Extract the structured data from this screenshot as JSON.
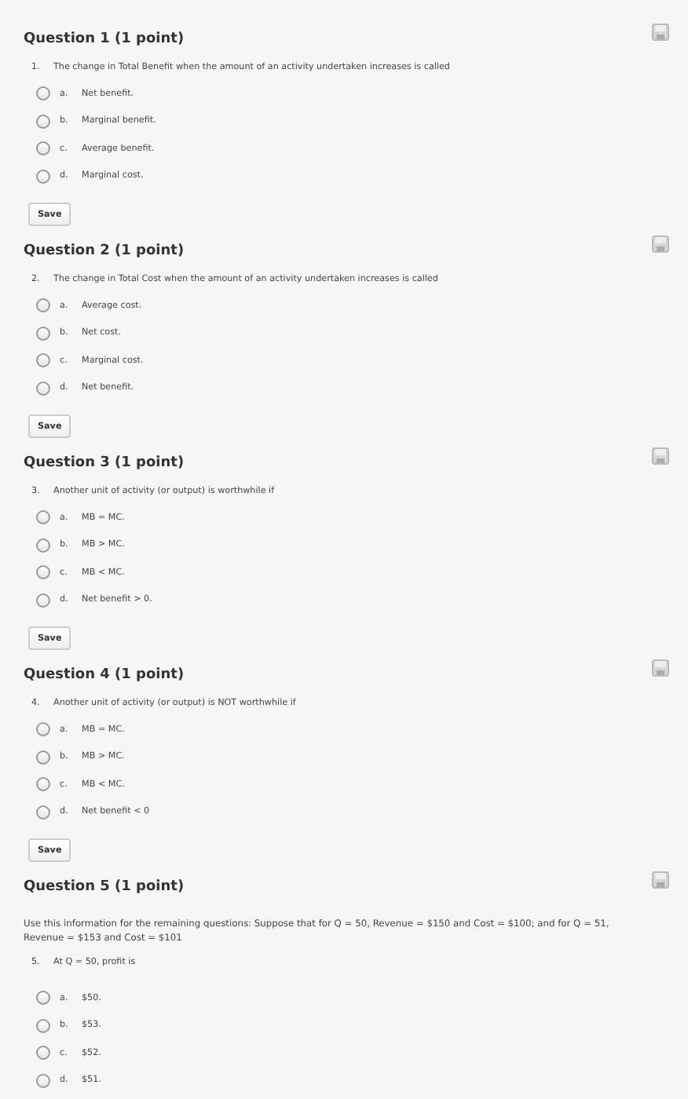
{
  "questions": [
    {
      "title": "Question 1 (1 point)",
      "number": "1.",
      "prompt": "The change in Total Benefit when the amount of an activity undertaken increases is called",
      "options": [
        {
          "letter": "a.",
          "text": "Net benefit.",
          "selected": false
        },
        {
          "letter": "b.",
          "text": "Marginal benefit.",
          "selected": false
        },
        {
          "letter": "c.",
          "text": "Average benefit.",
          "selected": false
        },
        {
          "letter": "d.",
          "text": "Marginal cost.",
          "selected": false
        }
      ],
      "save": "Save"
    },
    {
      "title": "Question 2 (1 point)",
      "number": "2.",
      "prompt": "The change in Total Cost when the amount of an activity undertaken increases is called",
      "options": [
        {
          "letter": "a.",
          "text": "Average cost.",
          "selected": false
        },
        {
          "letter": "b.",
          "text": "Net cost.",
          "selected": false
        },
        {
          "letter": "c.",
          "text": "Marginal cost.",
          "selected": false
        },
        {
          "letter": "d.",
          "text": "Net benefit.",
          "selected": false
        }
      ],
      "save": "Save"
    },
    {
      "title": "Question 3 (1 point)",
      "number": "3.",
      "prompt": "Another unit of activity (or output) is worthwhile if",
      "options": [
        {
          "letter": "a.",
          "text": "MB = MC.",
          "selected": false
        },
        {
          "letter": "b.",
          "text": "MB > MC.",
          "selected": false
        },
        {
          "letter": "c.",
          "text": "MB < MC.",
          "selected": false
        },
        {
          "letter": "d.",
          "text": "Net benefit > 0.",
          "selected": false
        }
      ],
      "save": "Save"
    },
    {
      "title": "Question 4 (1 point)",
      "number": "4.",
      "prompt": "Another unit of activity (or output) is NOT worthwhile if",
      "options": [
        {
          "letter": "a.",
          "text": "MB = MC.",
          "selected": false
        },
        {
          "letter": "b.",
          "text": "MB > MC.",
          "selected": false
        },
        {
          "letter": "c.",
          "text": "MB < MC.",
          "selected": false
        },
        {
          "letter": "d.",
          "text": "Net benefit < 0",
          "selected": false
        }
      ],
      "save": "Save"
    },
    {
      "title": "Question 5 (1 point)",
      "intro": "Use this information for the remaining questions: Suppose that for Q = 50, Revenue = $150 and Cost = $100; and for Q = 51, Revenue = $153 and Cost = $101",
      "number": "5.",
      "prompt": "At Q = 50, profit is",
      "options": [
        {
          "letter": "a.",
          "text": "$50.",
          "selected": false
        },
        {
          "letter": "b.",
          "text": "$53.",
          "selected": false
        },
        {
          "letter": "c.",
          "text": "$52.",
          "selected": false
        },
        {
          "letter": "d.",
          "text": "$51.",
          "selected": false
        }
      ]
    }
  ]
}
